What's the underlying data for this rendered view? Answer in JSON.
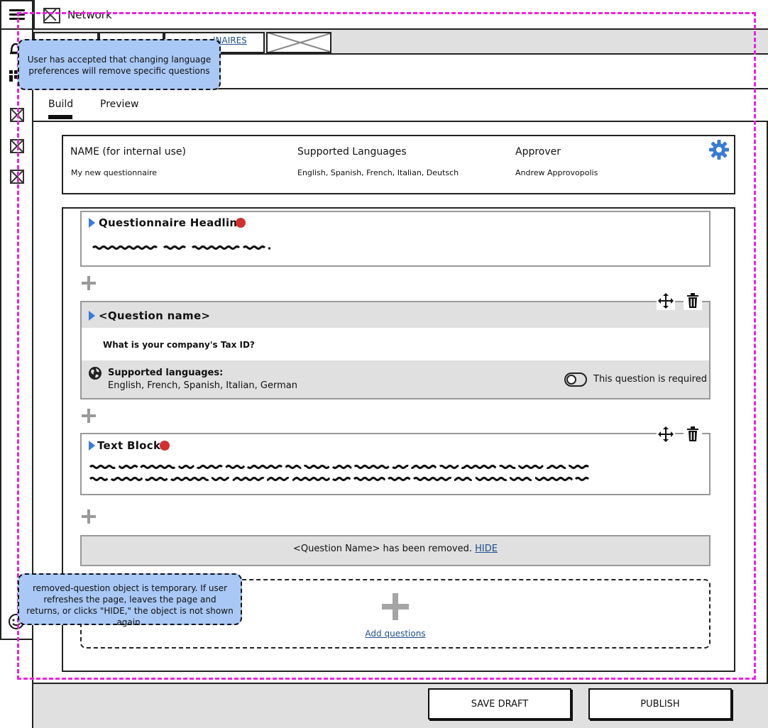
{
  "app": {
    "title": "Network"
  },
  "nav_tabs": {
    "questionnaires_label": "INAIRES"
  },
  "view_tabs": {
    "build": "Build",
    "preview": "Preview"
  },
  "info": {
    "name_label": "NAME (for internal use)",
    "name_value": "My new questionnaire",
    "languages_label": "Supported Languages",
    "languages_value": "English, Spanish, French, Italian, Deutsch",
    "approver_label": "Approver",
    "approver_value": "Andrew Approvopolis"
  },
  "builder": {
    "headline_block": {
      "title": "Questionnaire Headline",
      "required_dot": true
    },
    "question_block": {
      "title": "<Question name>",
      "question_text": "What is your company's Tax ID?",
      "languages_label": "Supported languages:",
      "languages_value": "English, French, Spanish, Italian, German",
      "required_label": "This question is required",
      "required_on": false
    },
    "text_block": {
      "title": "Text Block",
      "required_dot": true
    },
    "removed_notice": {
      "text": "<Question Name> has been removed. ",
      "hide_link": "HIDE"
    },
    "add_questions_label": "Add questions"
  },
  "footer": {
    "save_draft": "SAVE DRAFT",
    "publish": "PUBLISH"
  },
  "annotations": {
    "note_language": "User has accepted that changing language preferences will remove specific questions",
    "note_removed": "removed-question object is temporary. If user refreshes the page, leaves the page and returns, or clicks \"HIDE,\" the object is not shown again."
  },
  "colors": {
    "accent_blue": "#3a7bd5",
    "link_blue": "#1f4e8c",
    "required_red": "#d32f2f",
    "annotation_pink": "#ee22dd",
    "note_fill": "#a9c8f5"
  }
}
